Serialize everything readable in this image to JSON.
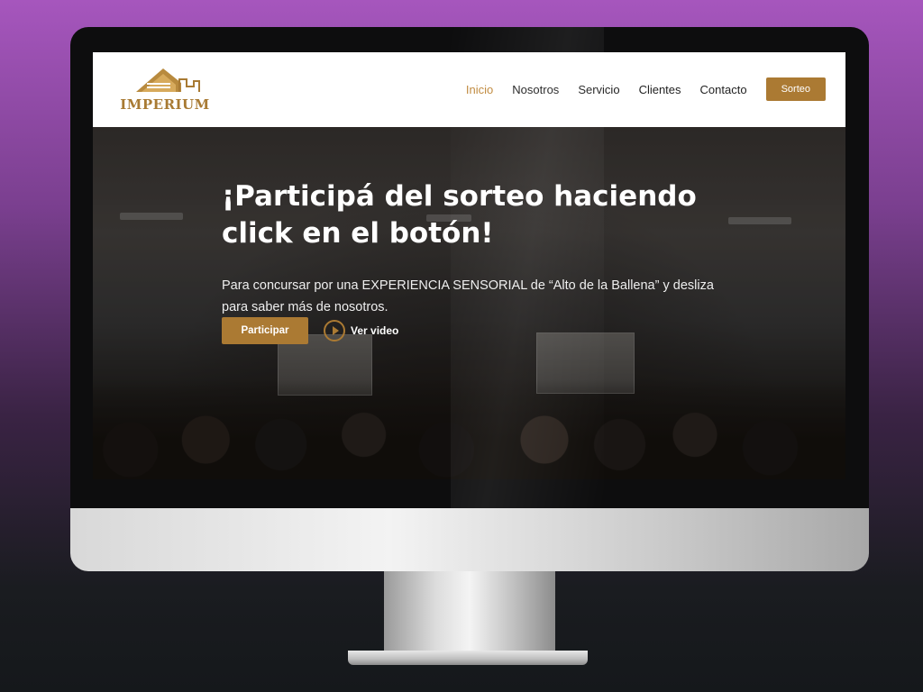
{
  "brand": {
    "logo_text": "IMPERIUM",
    "logo_icon": "house-roof-icon",
    "accent_color": "#ab7a33"
  },
  "nav": {
    "items": [
      {
        "label": "Inicio",
        "active": true
      },
      {
        "label": "Nosotros",
        "active": false
      },
      {
        "label": "Servicio",
        "active": false
      },
      {
        "label": "Clientes",
        "active": false
      },
      {
        "label": "Contacto",
        "active": false
      }
    ],
    "cta_label": "Sorteo"
  },
  "hero": {
    "title": "¡Participá del sorteo haciendo click en el botón!",
    "description": "Para concursar por una EXPERIENCIA SENSORIAL de “Alto de la Ballena” y desliza para saber más de nosotros.",
    "primary_button": "Participar",
    "video_link": "Ver video",
    "video_icon": "play-circle-icon"
  }
}
